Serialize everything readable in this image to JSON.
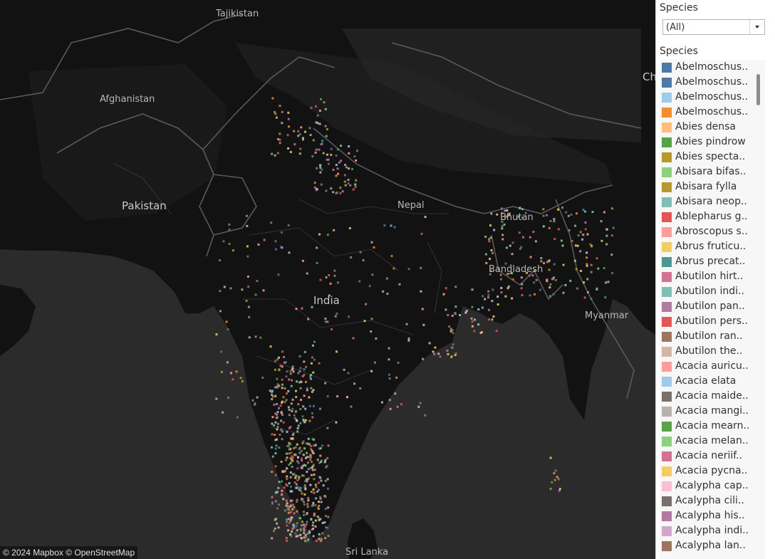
{
  "map": {
    "labels": {
      "tajikistan": "Tajikistan",
      "afghanistan": "Afghanistan",
      "pakistan": "Pakistan",
      "nepal": "Nepal",
      "bhutan": "Bhutan",
      "bangladesh": "Bangladesh",
      "india": "India",
      "myanmar": "Myanmar",
      "sri_lanka": "Sri Lanka",
      "china_partial": "Ch"
    },
    "attribution": "© 2024 Mapbox © OpenStreetMap",
    "colors": {
      "land": "#111111",
      "sea": "#2b2b2b",
      "borders": "#5a5a5a"
    }
  },
  "filter": {
    "title": "Species",
    "value": "(All)"
  },
  "legend": {
    "title": "Species",
    "items": [
      {
        "label": "Abelmoschus..",
        "color": "#4e79a7"
      },
      {
        "label": "Abelmoschus..",
        "color": "#4e79a7"
      },
      {
        "label": "Abelmoschus..",
        "color": "#a0cbe8"
      },
      {
        "label": "Abelmoschus..",
        "color": "#f28e2b"
      },
      {
        "label": "Abies densa",
        "color": "#ffbe7d"
      },
      {
        "label": "Abies pindrow",
        "color": "#59a14f"
      },
      {
        "label": "Abies specta..",
        "color": "#b6992d"
      },
      {
        "label": "Abisara bifas..",
        "color": "#8cd17d"
      },
      {
        "label": "Abisara fylla",
        "color": "#b6992d"
      },
      {
        "label": "Abisara neop..",
        "color": "#86bcb6"
      },
      {
        "label": "Ablepharus g..",
        "color": "#e15759"
      },
      {
        "label": "Abroscopus s..",
        "color": "#ff9d9a"
      },
      {
        "label": "Abrus fruticu..",
        "color": "#f1ce63"
      },
      {
        "label": "Abrus precat..",
        "color": "#499894"
      },
      {
        "label": "Abutilon hirt..",
        "color": "#d37295"
      },
      {
        "label": "Abutilon indi..",
        "color": "#86bcb6"
      },
      {
        "label": "Abutilon pan..",
        "color": "#b07aa1"
      },
      {
        "label": "Abutilon pers..",
        "color": "#e15759"
      },
      {
        "label": "Abutilon ran..",
        "color": "#9d7660"
      },
      {
        "label": "Abutilon the..",
        "color": "#d7b5a6"
      },
      {
        "label": "Acacia auricu..",
        "color": "#ff9d9a"
      },
      {
        "label": "Acacia elata",
        "color": "#a0cbe8"
      },
      {
        "label": "Acacia maide..",
        "color": "#79706e"
      },
      {
        "label": "Acacia mangi..",
        "color": "#bab0ac"
      },
      {
        "label": "Acacia mearn..",
        "color": "#59a14f"
      },
      {
        "label": "Acacia melan..",
        "color": "#8cd17d"
      },
      {
        "label": "Acacia neriif..",
        "color": "#d37295"
      },
      {
        "label": "Acacia pycna..",
        "color": "#f1ce63"
      },
      {
        "label": "Acalypha cap..",
        "color": "#fabfd2"
      },
      {
        "label": "Acalypha cili..",
        "color": "#79706e"
      },
      {
        "label": "Acalypha his..",
        "color": "#b07aa1"
      },
      {
        "label": "Acalypha indi..",
        "color": "#d4a6c8"
      },
      {
        "label": "Acalypha lan..",
        "color": "#9d7660"
      }
    ]
  }
}
